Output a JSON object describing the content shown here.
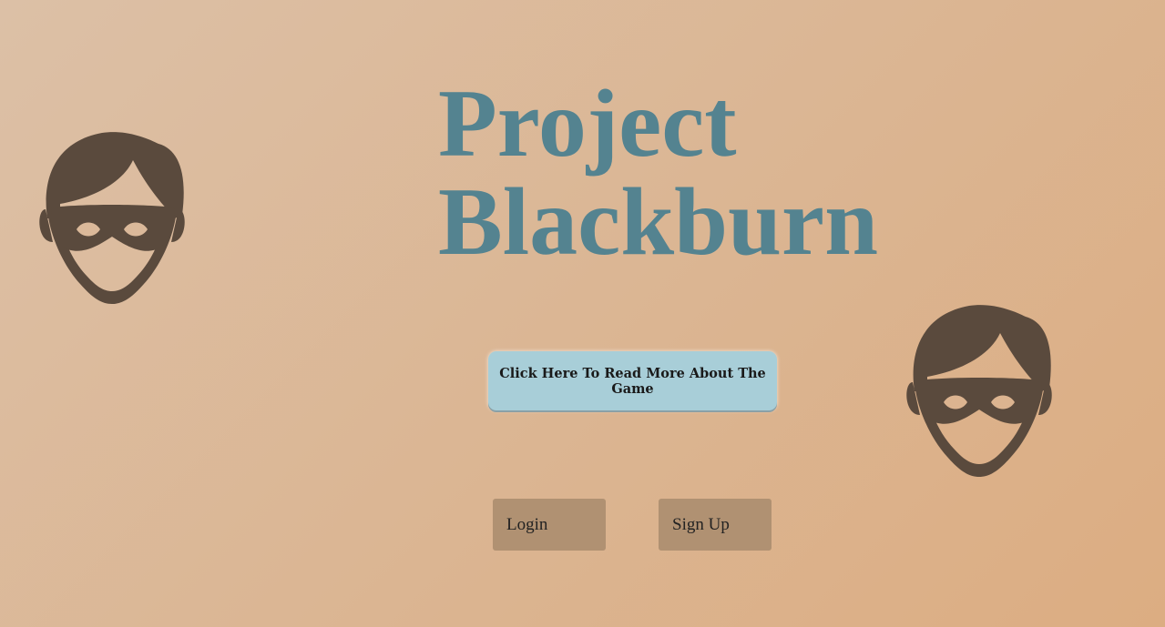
{
  "header": {
    "title_line1": "Project",
    "title_line2": "Blackburn"
  },
  "main": {
    "read_more_label": "Click Here To Read More About The Game",
    "login_label": "Login",
    "signup_label": "Sign Up"
  },
  "icons": {
    "left": "masked-thief-icon",
    "right": "masked-thief-icon"
  },
  "colors": {
    "title": "#548390",
    "icon": "#5a4a3d",
    "read_more_bg": "#a8ced8",
    "auth_bg": "#b09172"
  }
}
